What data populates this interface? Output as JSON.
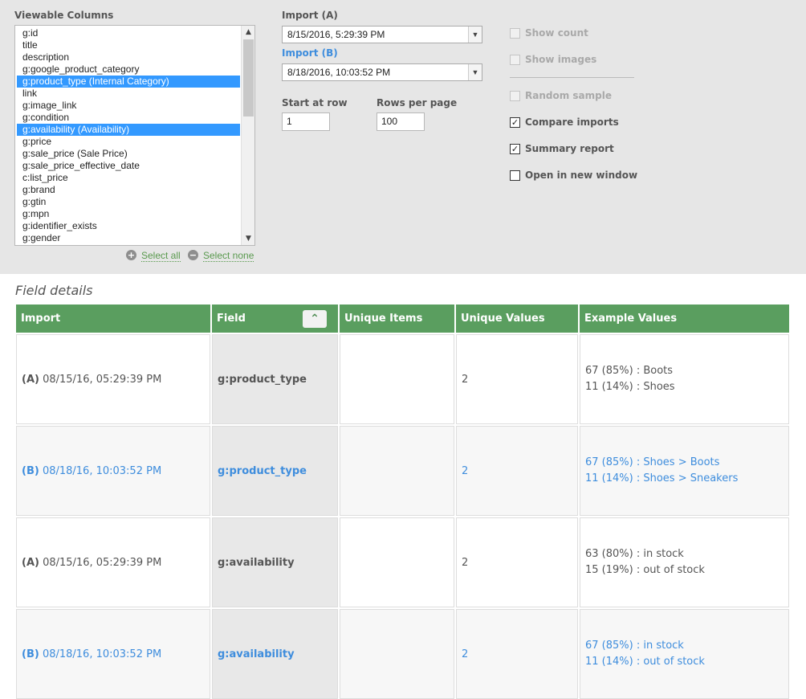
{
  "controls": {
    "viewable_columns_label": "Viewable Columns",
    "columns": [
      {
        "label": "g:id",
        "selected": false
      },
      {
        "label": "title",
        "selected": false
      },
      {
        "label": "description",
        "selected": false
      },
      {
        "label": "g:google_product_category",
        "selected": false
      },
      {
        "label": "g:product_type (Internal Category)",
        "selected": true
      },
      {
        "label": "link",
        "selected": false
      },
      {
        "label": "g:image_link",
        "selected": false
      },
      {
        "label": "g:condition",
        "selected": false
      },
      {
        "label": "g:availability (Availability)",
        "selected": true
      },
      {
        "label": "g:price",
        "selected": false
      },
      {
        "label": "g:sale_price (Sale Price)",
        "selected": false
      },
      {
        "label": "g:sale_price_effective_date",
        "selected": false
      },
      {
        "label": "c:list_price",
        "selected": false
      },
      {
        "label": "g:brand",
        "selected": false
      },
      {
        "label": "g:gtin",
        "selected": false
      },
      {
        "label": "g:mpn",
        "selected": false
      },
      {
        "label": "g:identifier_exists",
        "selected": false
      },
      {
        "label": "g:gender",
        "selected": false
      }
    ],
    "select_all": "Select all",
    "select_none": "Select none",
    "import_a_label": "Import (A)",
    "import_a_value": "8/15/2016, 5:29:39 PM",
    "import_b_label": "Import (B)",
    "import_b_value": "8/18/2016, 10:03:52 PM",
    "start_row_label": "Start at row",
    "start_row_value": "1",
    "rows_per_page_label": "Rows per page",
    "rows_per_page_value": "100",
    "options": [
      {
        "label": "Show count",
        "checked": false,
        "disabled": true
      },
      {
        "label": "Show images",
        "checked": false,
        "disabled": true
      },
      {
        "label": "Random sample",
        "checked": false,
        "disabled": true
      },
      {
        "label": "Compare imports",
        "checked": true,
        "disabled": false
      },
      {
        "label": "Summary report",
        "checked": true,
        "disabled": false
      },
      {
        "label": "Open in new window",
        "checked": false,
        "disabled": false
      }
    ]
  },
  "details": {
    "title": "Field details",
    "headers": [
      "Import",
      "Field",
      "Unique Items",
      "Unique Values",
      "Example Values"
    ],
    "rows": [
      {
        "prefix": "(A)",
        "import": "08/15/16, 05:29:39 PM",
        "field": "g:product_type",
        "unique_items": "",
        "unique_values": "2",
        "examples": [
          "67 (85%) : Boots",
          "11 (14%) : Shoes"
        ]
      },
      {
        "prefix": "(B)",
        "import": "08/18/16, 10:03:52 PM",
        "field": "g:product_type",
        "unique_items": "",
        "unique_values": "2",
        "examples": [
          "67 (85%) : Shoes > Boots",
          "11 (14%) : Shoes > Sneakers"
        ]
      },
      {
        "prefix": "(A)",
        "import": "08/15/16, 05:29:39 PM",
        "field": "g:availability",
        "unique_items": "",
        "unique_values": "2",
        "examples": [
          "63 (80%) : in stock",
          "15 (19%) : out of stock"
        ]
      },
      {
        "prefix": "(B)",
        "import": "08/18/16, 10:03:52 PM",
        "field": "g:availability",
        "unique_items": "",
        "unique_values": "2",
        "examples": [
          "67 (85%) : in stock",
          "11 (14%) : out of stock"
        ]
      }
    ]
  },
  "colors": {
    "header_green": "#5a9e5f",
    "link_blue": "#3e8ddd",
    "selection_blue": "#3399ff",
    "panel_gray": "#e6e6e6"
  }
}
